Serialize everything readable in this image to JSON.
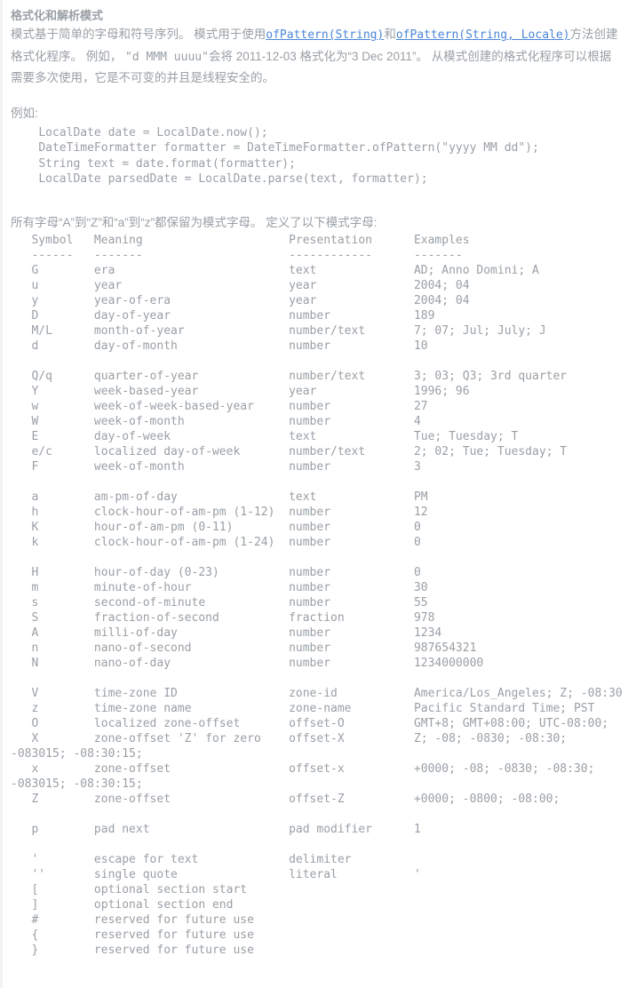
{
  "page": {
    "title": "格式化和解析模式",
    "accent_link_color": "#4a86d8",
    "body_text_color": "#9aa0a6",
    "background_color": "#ffffff",
    "left_border_color": "#f1f3f4"
  },
  "intro": {
    "part1": "模式基于简单的字母和符号序列。 模式用于使用",
    "link1": "ofPattern(String)",
    "part2": "和",
    "link2": "ofPattern(String, Locale)",
    "part3": "方法创建格式化程序。 例如， ",
    "inline_pattern": "\"d MMM uuuu\"",
    "part4": "会将 2011-12-03 格式化为“3 Dec 2011”。 从模式创建的格式化程序可以根据需要多次使用，它是不可变的并且是线程安全的。"
  },
  "example": {
    "label": "例如:",
    "code": "    LocalDate date = LocalDate.now();\n    DateTimeFormatter formatter = DateTimeFormatter.ofPattern(\"yyyy MM dd\");\n    String text = date.format(formatter);\n    LocalDate parsedDate = LocalDate.parse(text, formatter);"
  },
  "reserved_note": "所有字母“A”到“Z”和“a”到“z”都保留为模式字母。 定义了以下模式字母:",
  "pattern_table": {
    "columns": [
      "Symbol",
      "Meaning",
      "Presentation",
      "Examples"
    ],
    "separator_row": "  ------   -------                     ------------      -------",
    "header_row": "   Symbol  Meaning                     Presentation      Examples",
    "rows": [
      {
        "symbol": "G",
        "meaning": "era",
        "presentation": "text",
        "examples": "AD; Anno Domini; A"
      },
      {
        "symbol": "u",
        "meaning": "year",
        "presentation": "year",
        "examples": "2004; 04"
      },
      {
        "symbol": "y",
        "meaning": "year-of-era",
        "presentation": "year",
        "examples": "2004; 04"
      },
      {
        "symbol": "D",
        "meaning": "day-of-year",
        "presentation": "number",
        "examples": "189"
      },
      {
        "symbol": "M/L",
        "meaning": "month-of-year",
        "presentation": "number/text",
        "examples": "7; 07; Jul; July; J"
      },
      {
        "symbol": "d",
        "meaning": "day-of-month",
        "presentation": "number",
        "examples": "10"
      },
      {
        "symbol": "",
        "meaning": "",
        "presentation": "",
        "examples": ""
      },
      {
        "symbol": "Q/q",
        "meaning": "quarter-of-year",
        "presentation": "number/text",
        "examples": "3; 03; Q3; 3rd quarter"
      },
      {
        "symbol": "Y",
        "meaning": "week-based-year",
        "presentation": "year",
        "examples": "1996; 96"
      },
      {
        "symbol": "w",
        "meaning": "week-of-week-based-year",
        "presentation": "number",
        "examples": "27"
      },
      {
        "symbol": "W",
        "meaning": "week-of-month",
        "presentation": "number",
        "examples": "4"
      },
      {
        "symbol": "E",
        "meaning": "day-of-week",
        "presentation": "text",
        "examples": "Tue; Tuesday; T"
      },
      {
        "symbol": "e/c",
        "meaning": "localized day-of-week",
        "presentation": "number/text",
        "examples": "2; 02; Tue; Tuesday; T"
      },
      {
        "symbol": "F",
        "meaning": "week-of-month",
        "presentation": "number",
        "examples": "3"
      },
      {
        "symbol": "",
        "meaning": "",
        "presentation": "",
        "examples": ""
      },
      {
        "symbol": "a",
        "meaning": "am-pm-of-day",
        "presentation": "text",
        "examples": "PM"
      },
      {
        "symbol": "h",
        "meaning": "clock-hour-of-am-pm (1-12)",
        "presentation": "number",
        "examples": "12"
      },
      {
        "symbol": "K",
        "meaning": "hour-of-am-pm (0-11)",
        "presentation": "number",
        "examples": "0"
      },
      {
        "symbol": "k",
        "meaning": "clock-hour-of-am-pm (1-24)",
        "presentation": "number",
        "examples": "0"
      },
      {
        "symbol": "",
        "meaning": "",
        "presentation": "",
        "examples": ""
      },
      {
        "symbol": "H",
        "meaning": "hour-of-day (0-23)",
        "presentation": "number",
        "examples": "0"
      },
      {
        "symbol": "m",
        "meaning": "minute-of-hour",
        "presentation": "number",
        "examples": "30"
      },
      {
        "symbol": "s",
        "meaning": "second-of-minute",
        "presentation": "number",
        "examples": "55"
      },
      {
        "symbol": "S",
        "meaning": "fraction-of-second",
        "presentation": "fraction",
        "examples": "978"
      },
      {
        "symbol": "A",
        "meaning": "milli-of-day",
        "presentation": "number",
        "examples": "1234"
      },
      {
        "symbol": "n",
        "meaning": "nano-of-second",
        "presentation": "number",
        "examples": "987654321"
      },
      {
        "symbol": "N",
        "meaning": "nano-of-day",
        "presentation": "number",
        "examples": "1234000000"
      },
      {
        "symbol": "",
        "meaning": "",
        "presentation": "",
        "examples": ""
      },
      {
        "symbol": "V",
        "meaning": "time-zone ID",
        "presentation": "zone-id",
        "examples": "America/Los_Angeles; Z; -08:30"
      },
      {
        "symbol": "z",
        "meaning": "time-zone name",
        "presentation": "zone-name",
        "examples": "Pacific Standard Time; PST"
      },
      {
        "symbol": "O",
        "meaning": "localized zone-offset",
        "presentation": "offset-O",
        "examples": "GMT+8; GMT+08:00; UTC-08:00;"
      },
      {
        "symbol": "X",
        "meaning": "zone-offset 'Z' for zero",
        "presentation": "offset-X",
        "examples": "Z; -08; -0830; -08:30; -083015; -08:30:15;"
      },
      {
        "symbol": "x",
        "meaning": "zone-offset",
        "presentation": "offset-x",
        "examples": "+0000; -08; -0830; -08:30; -083015; -08:30:15;"
      },
      {
        "symbol": "Z",
        "meaning": "zone-offset",
        "presentation": "offset-Z",
        "examples": "+0000; -0800; -08:00;"
      },
      {
        "symbol": "",
        "meaning": "",
        "presentation": "",
        "examples": ""
      },
      {
        "symbol": "p",
        "meaning": "pad next",
        "presentation": "pad modifier",
        "examples": "1"
      },
      {
        "symbol": "",
        "meaning": "",
        "presentation": "",
        "examples": ""
      },
      {
        "symbol": "'",
        "meaning": "escape for text",
        "presentation": "delimiter",
        "examples": ""
      },
      {
        "symbol": "''",
        "meaning": "single quote",
        "presentation": "literal",
        "examples": "'"
      },
      {
        "symbol": "[",
        "meaning": "optional section start",
        "presentation": "",
        "examples": ""
      },
      {
        "symbol": "]",
        "meaning": "optional section end",
        "presentation": "",
        "examples": ""
      },
      {
        "symbol": "#",
        "meaning": "reserved for future use",
        "presentation": "",
        "examples": ""
      },
      {
        "symbol": "{",
        "meaning": "reserved for future use",
        "presentation": "",
        "examples": ""
      },
      {
        "symbol": "}",
        "meaning": "reserved for future use",
        "presentation": "",
        "examples": ""
      }
    ]
  }
}
